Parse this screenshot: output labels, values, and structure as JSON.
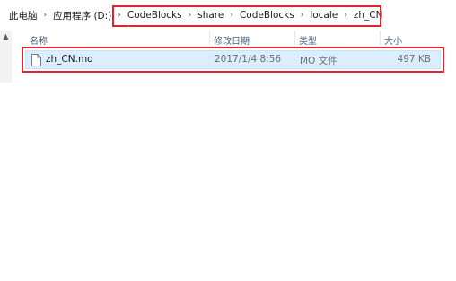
{
  "breadcrumb": {
    "items": [
      "此电脑",
      "应用程序 (D:)",
      "CodeBlocks",
      "share",
      "CodeBlocks",
      "locale",
      "zh_CN"
    ],
    "separator": "›"
  },
  "columns": {
    "name": "名称",
    "date": "修改日期",
    "type": "类型",
    "size": "大小"
  },
  "files": [
    {
      "name": "zh_CN.mo",
      "modified": "2017/1/4 8:56",
      "type": "MO 文件",
      "size": "497 KB",
      "icon": "file-icon"
    }
  ],
  "colors": {
    "highlight": "#e0242f",
    "selection": "#dceefd",
    "header_text": "#4d6082"
  }
}
